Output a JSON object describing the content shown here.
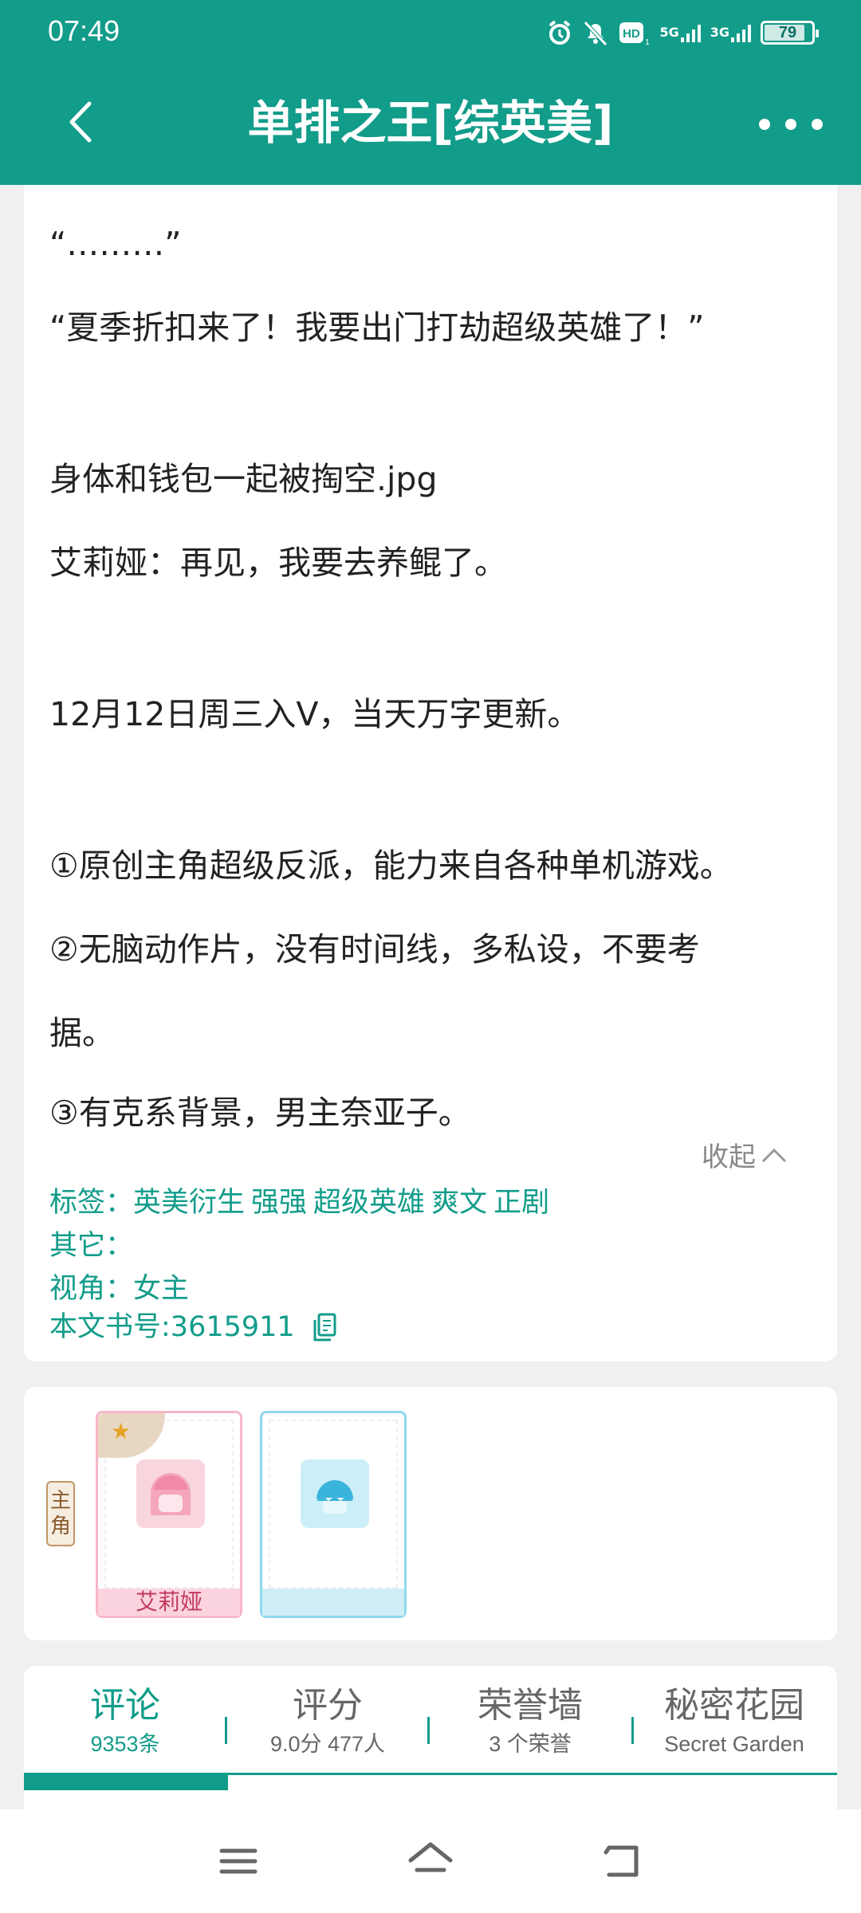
{
  "status_bar": {
    "time": "07:49",
    "net1": "5G",
    "net2": "3G",
    "battery": "79",
    "icons": [
      "alarm-icon",
      "mute-icon",
      "hd-icon",
      "signal-icon",
      "signal-icon",
      "battery-icon"
    ]
  },
  "header": {
    "title": "单排之王[综英美]",
    "back_icon": "chevron-left-icon",
    "more_icon": "more-dots-icon"
  },
  "description": {
    "lines": [
      "“………”",
      "“夏季折扣来了！我要出门打劫超级英雄了！”",
      "身体和钱包一起被掏空.jpg",
      "艾莉娅：再见，我要去养鲲了。",
      "12月12日周三入V，当天万字更新。",
      "①原创主角超级反派，能力来自各种单机游戏。",
      "②无脑动作片，没有时间线，多私设，不要考",
      "据。",
      "③有克系背景，男主奈亚子。"
    ],
    "collapse_label": "收起"
  },
  "meta": {
    "tags_label": "标签：",
    "tags": [
      "英美衍生",
      "强强",
      "超级英雄",
      "爽文",
      "正剧"
    ],
    "other_label": "其它：",
    "view_label": "视角：",
    "view_value": "女主",
    "book_id_label": "本文书号:",
    "book_id": "3615911"
  },
  "characters": {
    "role_badge": [
      "主",
      "角"
    ],
    "items": [
      {
        "name": "艾莉娅"
      },
      {
        "name": ""
      }
    ]
  },
  "tabs": [
    {
      "label": "评论",
      "sub": "9353条"
    },
    {
      "label": "评分",
      "sub": "9.0分 477人"
    },
    {
      "label": "荣誉墙",
      "sub": "3 个荣誉"
    },
    {
      "label": "秘密花园",
      "sub": "Secret Garden"
    }
  ],
  "navbar": {
    "icons": [
      "menu-icon",
      "home-icon",
      "back-icon"
    ]
  },
  "colors": {
    "accent": "#129c8a",
    "background": "#f0f0f0"
  }
}
